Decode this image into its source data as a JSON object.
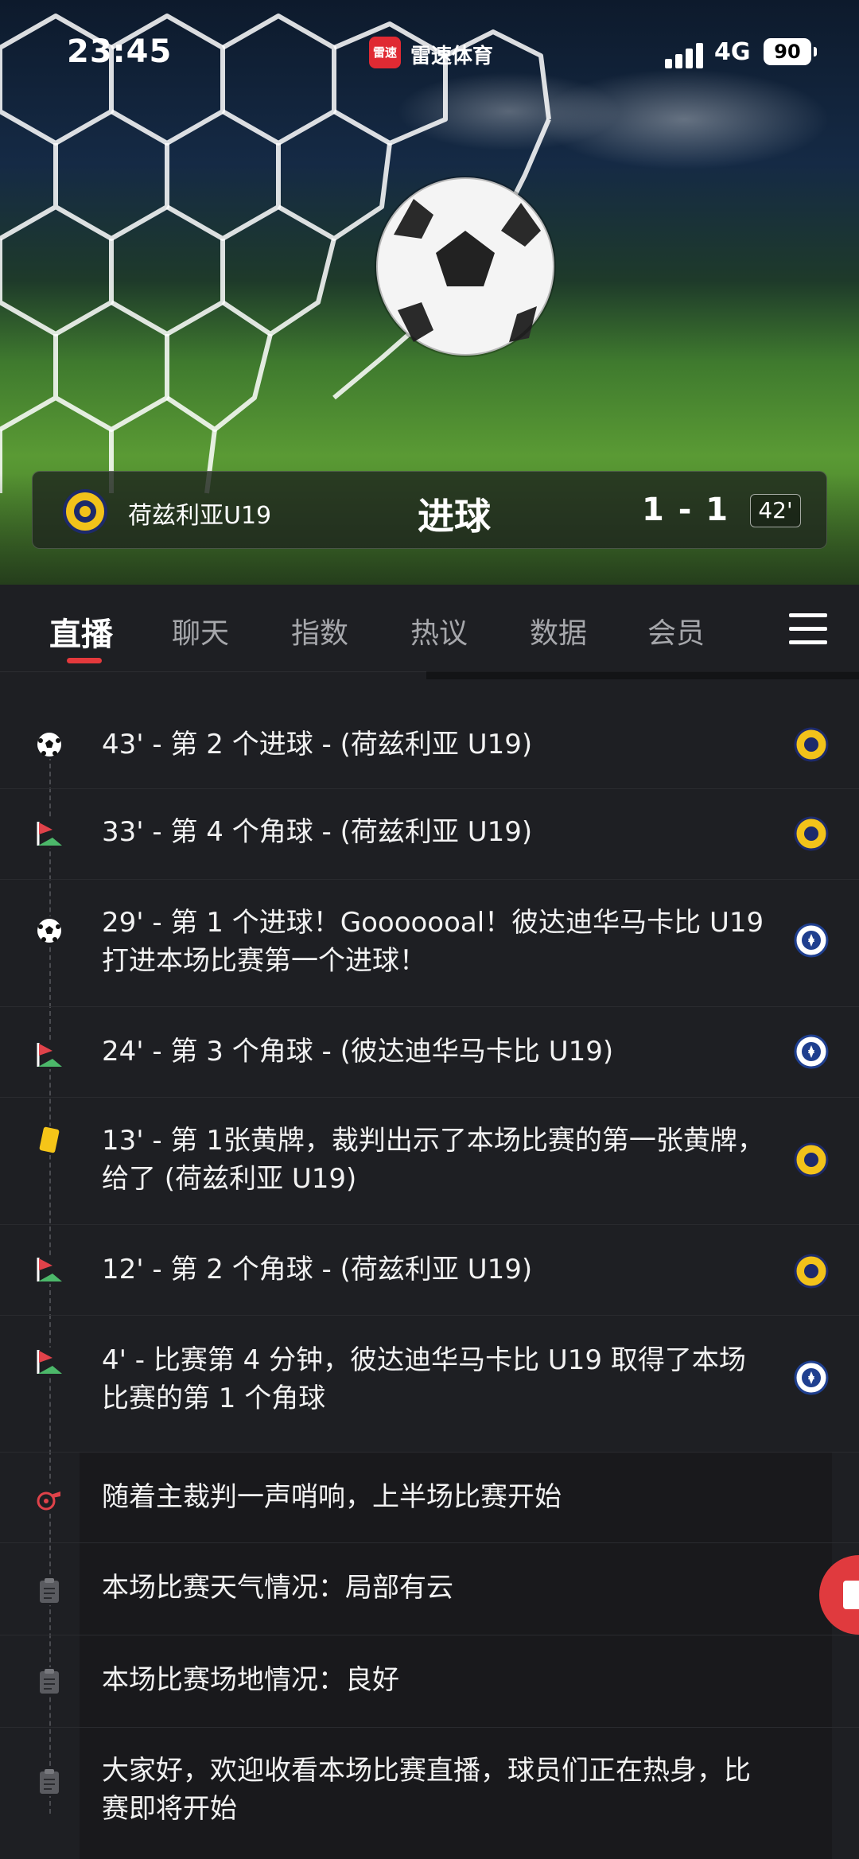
{
  "status_bar": {
    "time": "23:45",
    "app_badge": "雷速",
    "app_name": "雷速体育",
    "network": "4G",
    "battery": "90"
  },
  "scoreboard": {
    "team_name": "荷兹利亚U19",
    "event": "进球",
    "score": "1 - 1",
    "minute": "42'"
  },
  "tabs": [
    "直播",
    "聊天",
    "指数",
    "热议",
    "数据",
    "会员"
  ],
  "active_tab": "直播",
  "events": [
    {
      "icon": "soccer-ball-icon",
      "text": "43' - 第 2 个进球 - (荷兹利亚 U19)",
      "team": "home"
    },
    {
      "icon": "corner-flag-icon",
      "text": "33' - 第 4 个角球 - (荷兹利亚 U19)",
      "team": "home"
    },
    {
      "icon": "soccer-ball-icon",
      "text": "29' - 第 1 个进球！Gooooooal！彼达迪华马卡比 U19 打进本场比赛第一个进球！",
      "team": "away"
    },
    {
      "icon": "corner-flag-icon",
      "text": "24' - 第 3 个角球 - (彼达迪华马卡比 U19)",
      "team": "away"
    },
    {
      "icon": "yellow-card-icon",
      "text": "13' - 第 1张黄牌，裁判出示了本场比赛的第一张黄牌，给了 (荷兹利亚 U19)",
      "team": "home"
    },
    {
      "icon": "corner-flag-icon",
      "text": "12' - 第 2 个角球 - (荷兹利亚 U19)",
      "team": "home"
    },
    {
      "icon": "corner-flag-icon",
      "text": "4' - 比赛第 4 分钟，彼达迪华马卡比 U19 取得了本场比赛的第 1 个角球",
      "team": "away"
    },
    {
      "icon": "whistle-icon",
      "text": "随着主裁判一声哨响，上半场比赛开始",
      "team": "none"
    },
    {
      "icon": "clipboard-icon",
      "text": "本场比赛天气情况：局部有云",
      "team": "none"
    },
    {
      "icon": "clipboard-icon",
      "text": "本场比赛场地情况：良好",
      "team": "none"
    },
    {
      "icon": "clipboard-icon",
      "text": "大家好，欢迎收看本场比赛直播，球员们正在热身，比赛即将开始",
      "team": "none"
    }
  ],
  "colors": {
    "accent": "#e4393c",
    "background": "#1e1f23",
    "home_badge": "#f2c21a",
    "away_badge": "#1f3f8f",
    "yellow_card": "#f5c518",
    "corner_flag_red": "#e0424a",
    "corner_flag_green": "#4cb86a"
  }
}
